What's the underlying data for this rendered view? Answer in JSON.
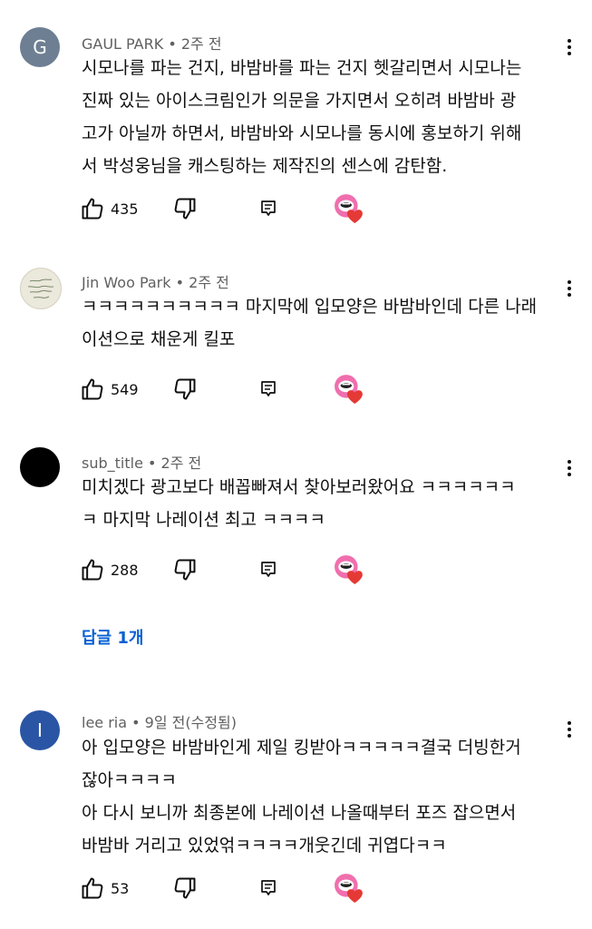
{
  "comments": [
    {
      "author": "GAUL PARK",
      "time": "2주 전",
      "avatar_letter": "G",
      "avatar_color": "#6e7f93",
      "lines": [
        "시모나를 파는 건지, 바밤바를 파는 건지 헷갈리면서 시모나는",
        "진짜 있는 아이스크림인가 의문을 가지면서 오히려 바밤바 광",
        "고가 아닐까 하면서, 바밤바와 시모나를 동시에 홍보하기 위해",
        "서 박성웅님을 캐스팅하는 제작진의 센스에 감탄함."
      ],
      "likes": "435"
    },
    {
      "author": "Jin Woo Park",
      "time": "2주 전",
      "avatar_letter": "",
      "avatar_color": "#e9e6d8",
      "lines": [
        "ㅋㅋㅋㅋㅋㅋㅋㅋㅋㅋ 마지막에 입모양은 바밤바인데 다른 나래",
        "이션으로 채운게 킬포"
      ],
      "likes": "549"
    },
    {
      "author": "sub_title",
      "time": "2주 전",
      "avatar_letter": "",
      "avatar_color": "#000000",
      "lines": [
        "미치겠다 광고보다 배꼽빠져서 찾아보러왔어요 ㅋㅋㅋㅋㅋㅋ",
        "ㅋ 마지막 나레이션 최고 ㅋㅋㅋㅋ"
      ],
      "likes": "288",
      "reply_label": "답글 1개"
    },
    {
      "author": "lee ria",
      "time": "9일 전(수정됨)",
      "avatar_letter": "I",
      "avatar_color": "#2a55a4",
      "lines": [
        "아 입모양은 바밤바인게 제일 킹받아ㅋㅋㅋㅋㅋ결국 더빙한거",
        "잖아ㅋㅋㅋㅋ",
        "아 다시 보니까 최종본에 나레이션 나올때부터 포즈 잡으면서",
        "바밤바 거리고 있었얶ㅋㅋㅋㅋ개웃긴데 귀엽다ㅋㅋ"
      ],
      "likes": "53"
    }
  ],
  "icons": {
    "like": "thumbs-up-icon",
    "dislike": "thumbs-down-icon",
    "reply": "reply-comment-icon",
    "creator_heart": "creator-heart-icon",
    "more": "more-vert-icon"
  },
  "colors": {
    "link": "#065fd4",
    "heart": "#e53935",
    "meta": "#606060"
  }
}
